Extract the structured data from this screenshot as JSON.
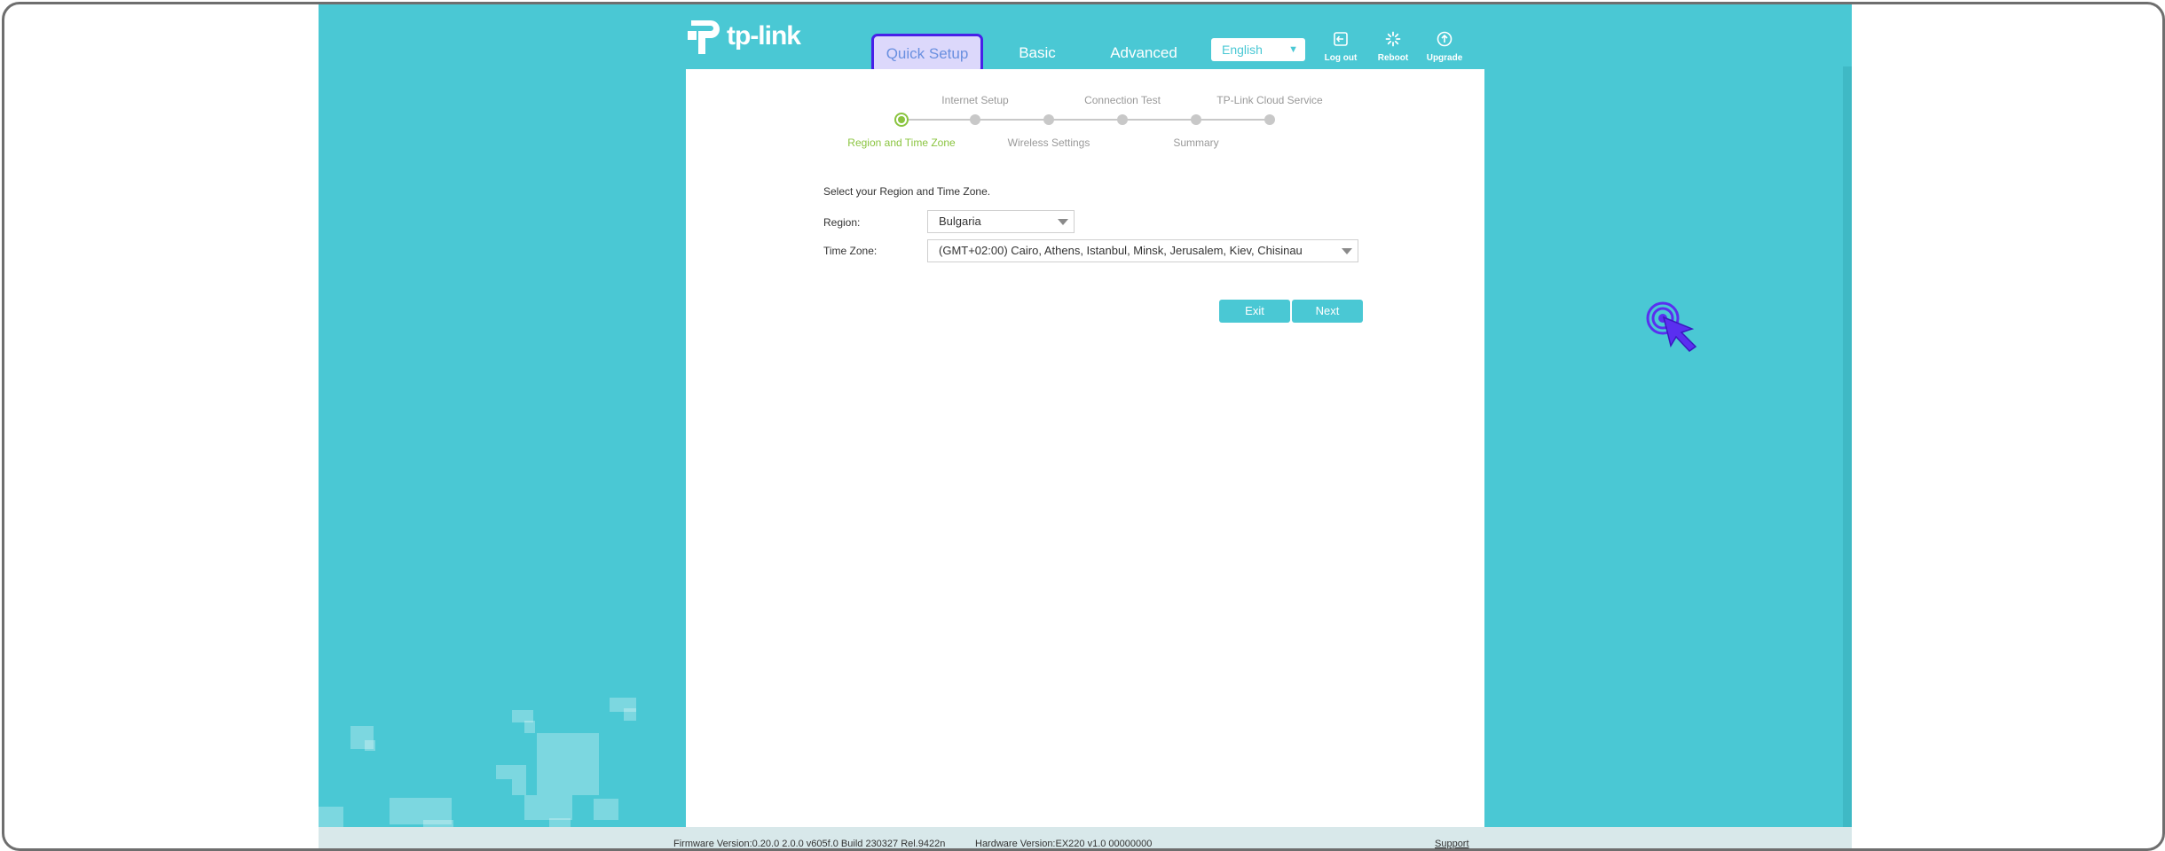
{
  "brand": {
    "logo_text": "tp-link"
  },
  "nav": {
    "quick_setup": "Quick Setup",
    "basic": "Basic",
    "advanced": "Advanced"
  },
  "language": {
    "selected": "English"
  },
  "top_icons": {
    "logout": "Log out",
    "reboot": "Reboot",
    "upgrade": "Upgrade"
  },
  "steps": {
    "top": [
      "Internet Setup",
      "Connection Test",
      "TP-Link Cloud Service"
    ],
    "bottom": [
      "Region and Time Zone",
      "Wireless Settings",
      "Summary"
    ],
    "active_index": 0
  },
  "form": {
    "intro": "Select your Region and Time Zone.",
    "region_label": "Region:",
    "region_value": "Bulgaria",
    "timezone_label": "Time Zone:",
    "timezone_value": "(GMT+02:00) Cairo, Athens, Istanbul, Minsk, Jerusalem, Kiev, Chisinau"
  },
  "buttons": {
    "exit": "Exit",
    "next": "Next"
  },
  "footer": {
    "firmware": "Firmware Version:0.20.0 2.0.0 v605f.0 Build 230327 Rel.9422n",
    "hardware": "Hardware Version:EX220 v1.0 00000000",
    "support": "Support"
  },
  "colors": {
    "accent": "#4ac8d4",
    "step_active": "#8ac43f",
    "highlight_border": "#4820e8",
    "cursor": "#5a2ff0"
  }
}
